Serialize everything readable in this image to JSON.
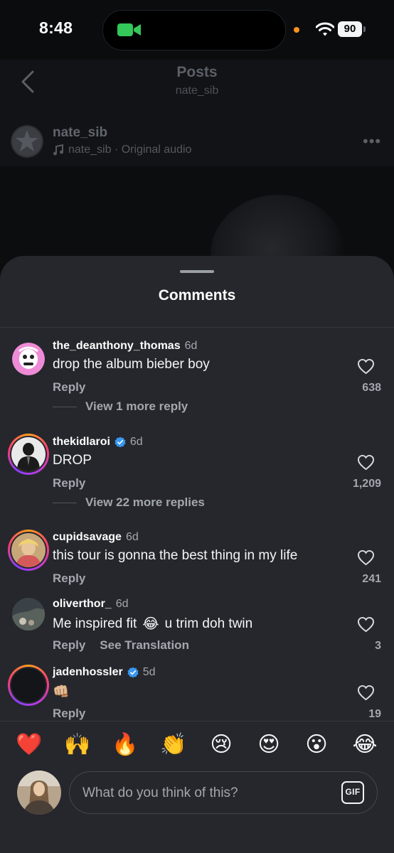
{
  "status_bar": {
    "time": "8:48",
    "battery": "90"
  },
  "header": {
    "title": "Posts",
    "subtitle": "nate_sib"
  },
  "post": {
    "username": "nate_sib",
    "audio": "nate_sib · Original audio",
    "more": "•••"
  },
  "sheet": {
    "title": "Comments"
  },
  "comments": [
    {
      "username": "the_deanthony_thomas",
      "age": "6d",
      "text": "drop the album bieber boy",
      "reply": "Reply",
      "more_replies": "View 1 more reply",
      "likes": "638"
    },
    {
      "username": "thekidlaroi",
      "age": "6d",
      "text": "DROP",
      "reply": "Reply",
      "more_replies": "View 22 more replies",
      "likes": "1,209",
      "verified": true
    },
    {
      "username": "cupidsavage",
      "age": "6d",
      "text": "this tour is gonna the best thing in my life",
      "reply": "Reply",
      "likes": "241"
    },
    {
      "username": "oliverthor_",
      "age": "6d",
      "text_before": "Me inspired fit",
      "emoji": "😂",
      "text_after": "u trim doh twin",
      "reply": "Reply",
      "translation": "See Translation",
      "likes": "3"
    },
    {
      "username": "jadenhossler",
      "age": "5d",
      "text": "👊🏼",
      "reply": "Reply",
      "likes": "19",
      "verified": true
    }
  ],
  "reactions": [
    "❤️",
    "🙌",
    "🔥",
    "👏",
    "😢",
    "😍",
    "😮",
    "😂"
  ],
  "composer": {
    "placeholder": "What do you think of this?",
    "gif_label": "GIF"
  },
  "colors": {
    "sheet_bg": "#25272c",
    "verified_blue": "#3897f0",
    "text_secondary": "#a3a7ae"
  }
}
